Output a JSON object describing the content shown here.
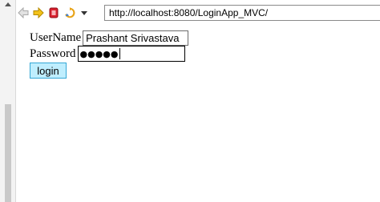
{
  "browser": {
    "url": "http://localhost:8080/LoginApp_MVC/",
    "toolbar_icons": [
      "back-arrow-icon",
      "forward-arrow-icon",
      "stop-icon",
      "refresh-icon",
      "dropdown-icon"
    ],
    "colors": {
      "back": "#d6d6d6",
      "forward": "#f2c21a",
      "stop": "#d9202e",
      "refresh": "#e8a317"
    }
  },
  "form": {
    "username_label": "UserName",
    "username_value": "Prashant Srivastava",
    "password_label": "Password",
    "password_masked": "●●●●●",
    "submit_label": "login"
  },
  "colors": {
    "button_bg": "#bfeefe",
    "button_border": "#35a8d6"
  }
}
